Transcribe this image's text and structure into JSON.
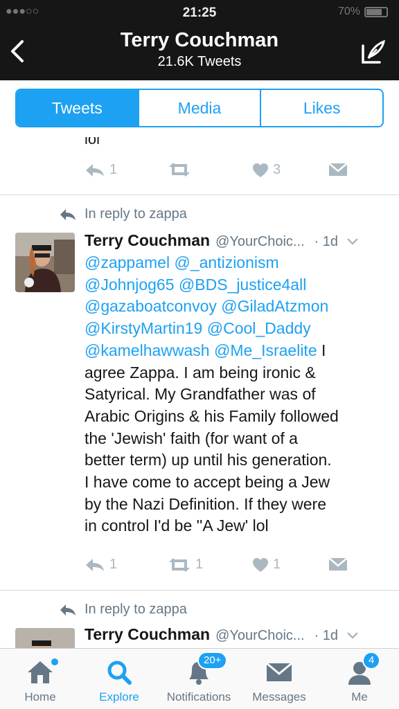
{
  "status": {
    "time": "21:25",
    "battery": "70%"
  },
  "header": {
    "title": "Terry Couchman",
    "subtitle": "21.6K Tweets"
  },
  "tabs": [
    {
      "label": "Tweets",
      "active": true
    },
    {
      "label": "Media",
      "active": false
    },
    {
      "label": "Likes",
      "active": false
    }
  ],
  "tweet_prev": {
    "cut_text": "lol",
    "actions": {
      "reply": "1",
      "retweet": "",
      "like": "3"
    }
  },
  "tweet1": {
    "reply_context": "In reply to zappa",
    "name": "Terry Couchman",
    "handle": "@YourChoic...",
    "time": "· 1d",
    "mentions": {
      "m1": "@zappamel",
      "m2": "@_antizionism",
      "m3": "@Johnjog65",
      "m4": "@BDS_justice4all",
      "m5": "@gazaboatconvoy",
      "m6": "@GiladAtzmon",
      "m7": "@KirstyMartin19",
      "m8": "@Cool_Daddy",
      "m9": "@kamelhawwash",
      "m10": "@Me_Israelite"
    },
    "text_lines": {
      "l1": " I",
      "l2": "agree Zappa. I am being ironic &",
      "l3": "Satyrical. My Grandfather was of",
      "l4": "Arabic Origins & his Family followed",
      "l5": "the 'Jewish' faith (for want of a",
      "l6": "better term) up until his generation.",
      "l7": "I have come to accept being a Jew",
      "l8": "by the Nazi Definition. If they were",
      "l9": "in control I'd be ''A Jew' lol"
    },
    "actions": {
      "reply": "1",
      "retweet": "1",
      "like": "1"
    }
  },
  "tweet2": {
    "reply_context": "In reply to zappa",
    "name": "Terry Couchman",
    "handle": "@YourChoic...",
    "time": "· 1d"
  },
  "nav": {
    "home": "Home",
    "explore": "Explore",
    "notifications": "Notifications",
    "notifications_badge": "20+",
    "messages": "Messages",
    "me": "Me",
    "me_badge": "4"
  },
  "colors": {
    "accent": "#1da1f2",
    "header_bg": "#161616",
    "icon_gray": "#aab8c2"
  }
}
